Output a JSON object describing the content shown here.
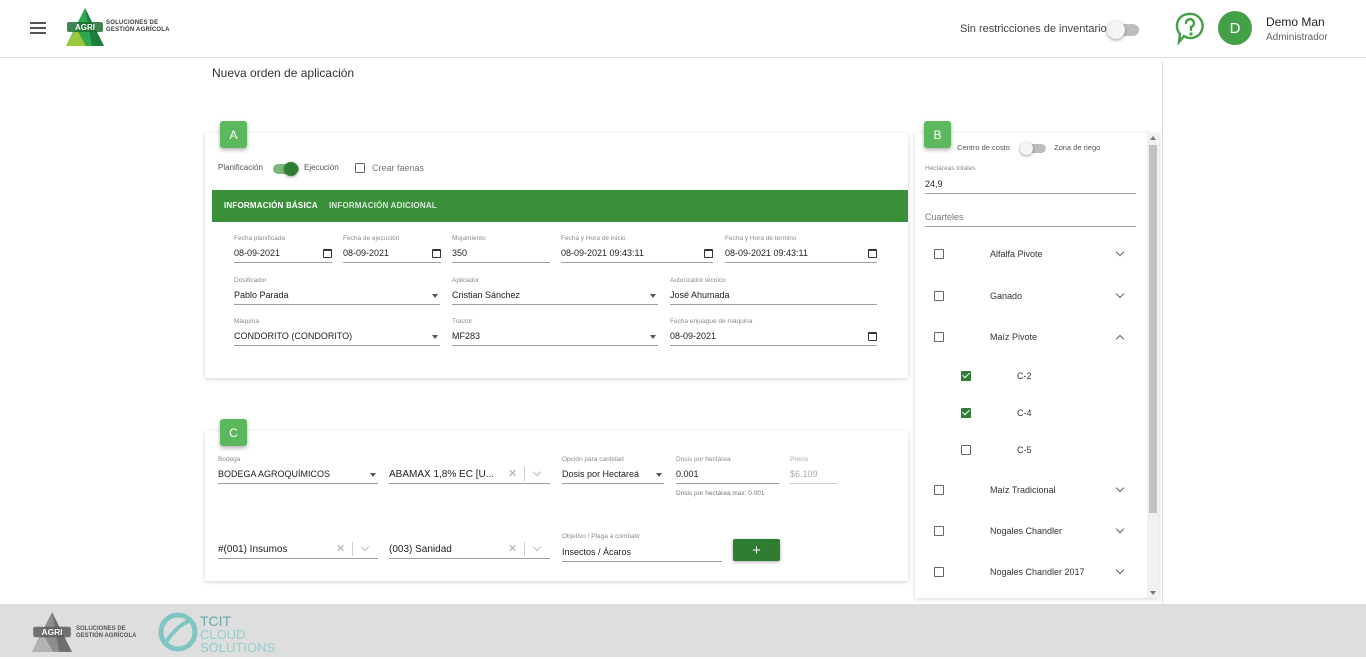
{
  "header": {
    "brand_logo_text": "AGRI",
    "brand_tagline_1": "SOLUCIONES DE",
    "brand_tagline_2": "GESTIÓN AGRÍCOLA",
    "inventory_toggle_label": "Sin restricciones de inventario",
    "avatar_initial": "D",
    "user_name": "Demo Man",
    "user_role": "Administrador"
  },
  "page": {
    "title": "Nueva orden de aplicación"
  },
  "section_a": {
    "badge": "A",
    "mode_left": "Planificación",
    "mode_right": "Ejecución",
    "create_tasks_label": "Crear faenas",
    "tabs": [
      "INFORMACIÓN BÁSICA",
      "INFORMACIÓN ADICIONAL"
    ],
    "fields": {
      "planned_date_label": "Fecha planificada",
      "planned_date": "08-09-2021",
      "execution_date_label": "Fecha de ejecución",
      "execution_date": "08-09-2021",
      "wetting_label": "Mojamiento",
      "wetting": "350",
      "start_label": "Fecha y Hora de inicio",
      "start": "08-09-2021 09:43:11",
      "end_label": "Fecha y Hora de termino",
      "end": "08-09-2021 09:43:11",
      "dosifier_label": "Dosificador",
      "dosifier": "Pablo Parada",
      "applicator_label": "Aplicador",
      "applicator": "Cristian Sánchez",
      "tech_auth_label": "Autorizador técnico",
      "tech_auth": "José Ahumada",
      "machine_label": "Máquina",
      "machine": "CONDORITO (CONDORITO)",
      "tractor_label": "Tractor",
      "tractor": "MF283",
      "rinse_label": "Fecha enjuague de máquina",
      "rinse": "08-09-2021"
    }
  },
  "section_b": {
    "badge": "B",
    "left_label": "Centro de costo",
    "right_label": "Zona de riego",
    "hectares_label": "Hectáreas totales",
    "hectares": "24,9",
    "quarters_label": "Cuarteles",
    "items": [
      {
        "label": "Alfalfa Pivote",
        "checked": false,
        "expanded": false
      },
      {
        "label": "Ganado",
        "checked": false,
        "expanded": false
      },
      {
        "label": "Maíz Pivote",
        "checked": false,
        "expanded": true
      },
      {
        "label": "C-2",
        "checked": true,
        "child": true
      },
      {
        "label": "C-4",
        "checked": true,
        "child": true
      },
      {
        "label": "C-5",
        "checked": false,
        "child": true
      },
      {
        "label": "Maíz Tradicional",
        "checked": false,
        "expanded": false
      },
      {
        "label": "Nogales Chandler",
        "checked": false,
        "expanded": false
      },
      {
        "label": "Nogales Chandler 2017",
        "checked": false,
        "expanded": false
      }
    ]
  },
  "section_c": {
    "badge": "C",
    "warehouse_label": "Bodega",
    "warehouse": "BODEGA AGROQUÍMICOS",
    "product": "ABAMAX 1,8% EC [U...",
    "qty_option_label": "Opción para cantidad",
    "qty_option": "Dosis por Hectareá",
    "dose_label": "Dosis por hectárea",
    "dose": "0.001",
    "dose_hint": "Dosis por hectárea max: 0.001",
    "price_label": "Precio",
    "price": "$6.109",
    "category": "#(001) Insumos",
    "subcategory": "(003) Sanidad",
    "target_label": "Objetivo / Plaga a combatir",
    "target": "Insectos / Ácaros",
    "add_label": "+"
  },
  "footer": {
    "brand_logo_text": "AGRI",
    "brand_tagline_1": "SOLUCIONES DE",
    "brand_tagline_2": "GESTIÓN AGRÍCOLA",
    "partner_1": "TCIT",
    "partner_2": "CLOUD",
    "partner_3": "SOLUTIONS"
  }
}
